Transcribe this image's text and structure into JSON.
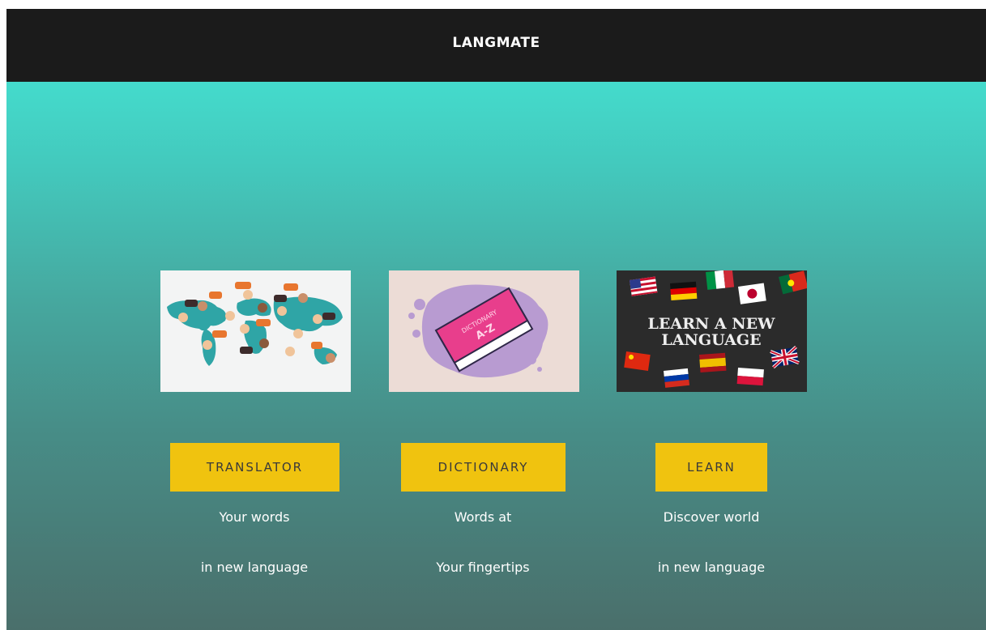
{
  "header": {
    "brand": "LANGMATE"
  },
  "cards": [
    {
      "button_label": "TRANSLATOR",
      "caption_line1": "Your words",
      "caption_line2": "in new language",
      "image": "world-map-people-speech-bubbles-illustration"
    },
    {
      "button_label": "DICTIONARY",
      "caption_line1": "Words at",
      "caption_line2": "Your fingertips",
      "image": "pink-dictionary-book-illustration",
      "book_text_1": "DICTIONARY",
      "book_text_2": "A-Z"
    },
    {
      "button_label": "LEARN",
      "caption_line1": "Discover world",
      "caption_line2": "in new language",
      "image": "chalkboard-flags-illustration",
      "board_text_1": "LEARN A NEW",
      "board_text_2": "LANGUAGE"
    }
  ],
  "colors": {
    "header_bg": "#1b1b1b",
    "button_bg": "#f0c30f",
    "gradient_top": "#44dbcc",
    "gradient_bottom": "#4a6f6b"
  }
}
